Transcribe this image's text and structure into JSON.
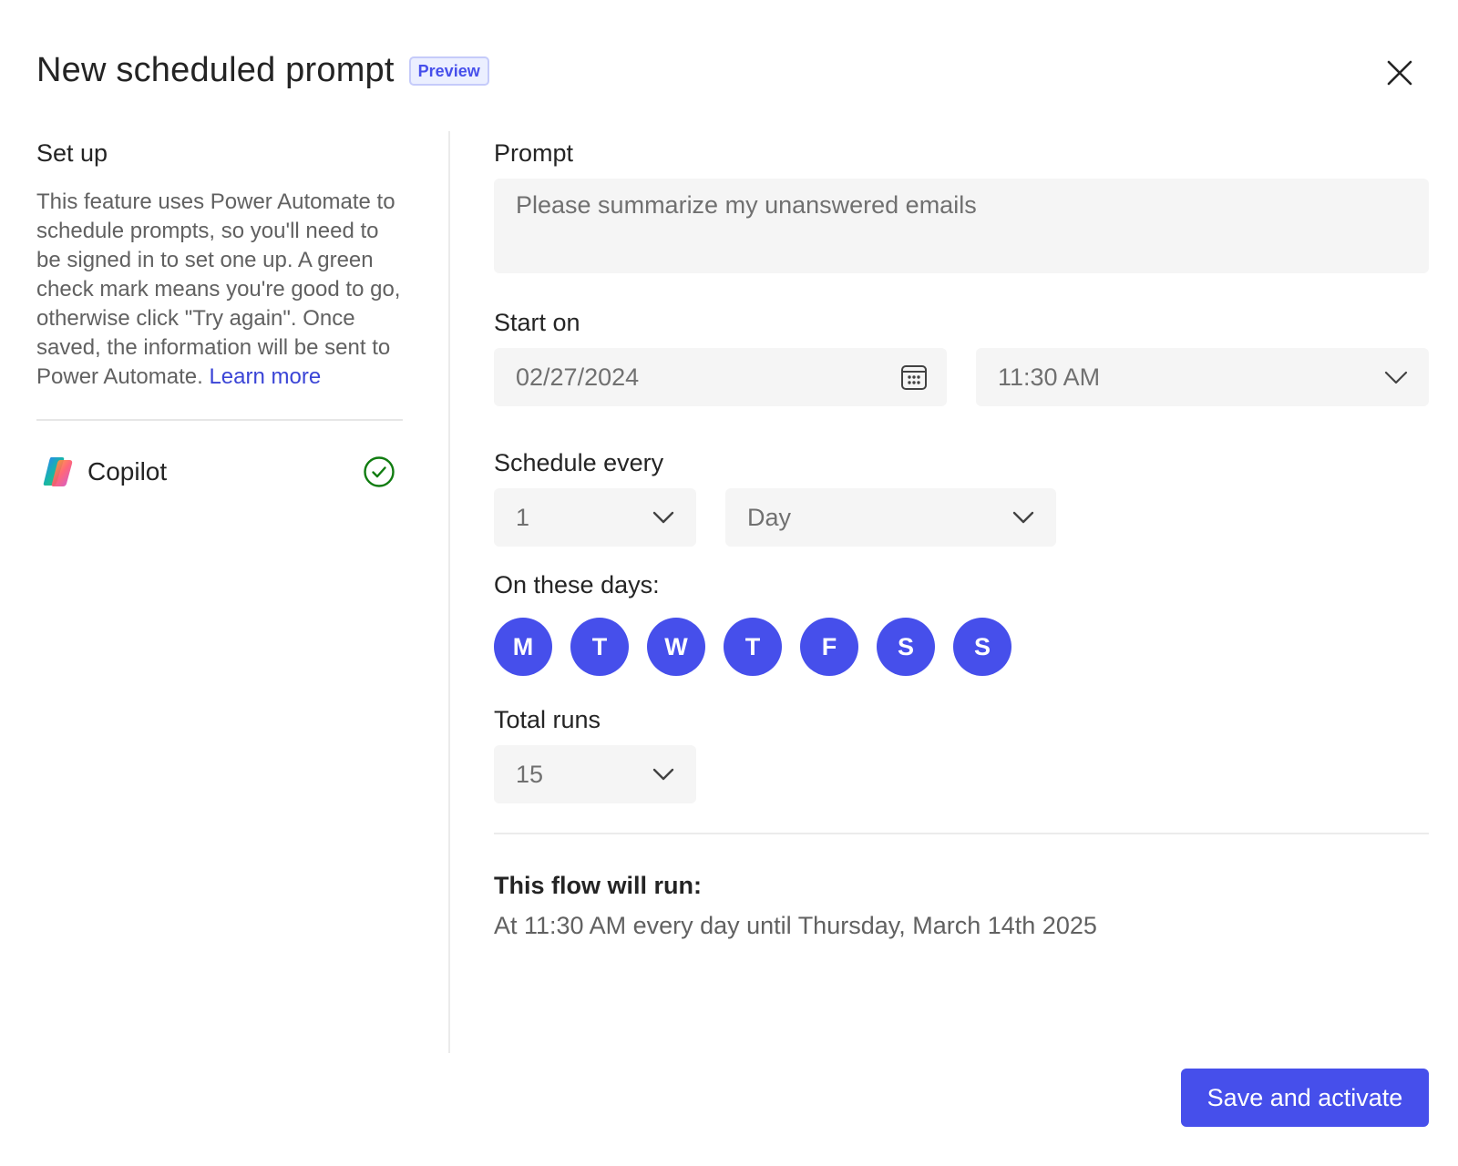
{
  "dialog": {
    "title": "New scheduled prompt",
    "badge": "Preview",
    "close_icon": "close-icon"
  },
  "setup": {
    "heading": "Set up",
    "description": "This feature uses Power Automate to schedule prompts, so you'll need to be signed in to set one up. A green check mark means you're good to go, otherwise click \"Try again\".  Once saved, the information will be sent to Power Automate.",
    "learn_more": "Learn more",
    "connection": {
      "name": "Copilot",
      "icon": "copilot-logo-icon",
      "status_icon": "check-circle-icon",
      "status_color": "#107c10"
    }
  },
  "form": {
    "prompt": {
      "label": "Prompt",
      "placeholder": "Please summarize my unanswered emails"
    },
    "start_on": {
      "label": "Start on",
      "date": "02/27/2024",
      "date_icon": "calendar-icon",
      "time": "11:30 AM",
      "time_icon": "chevron-down-icon"
    },
    "schedule_every": {
      "label": "Schedule every",
      "interval": "1",
      "unit": "Day"
    },
    "days": {
      "label": "On these days:",
      "items": [
        "M",
        "T",
        "W",
        "T",
        "F",
        "S",
        "S"
      ],
      "selected_color": "#464feb"
    },
    "total_runs": {
      "label": "Total runs",
      "value": "15"
    }
  },
  "summary": {
    "title": "This flow will run:",
    "text": "At 11:30 AM every day until Thursday, March 14th 2025"
  },
  "footer": {
    "save_label": "Save and activate",
    "accent": "#464feb"
  }
}
